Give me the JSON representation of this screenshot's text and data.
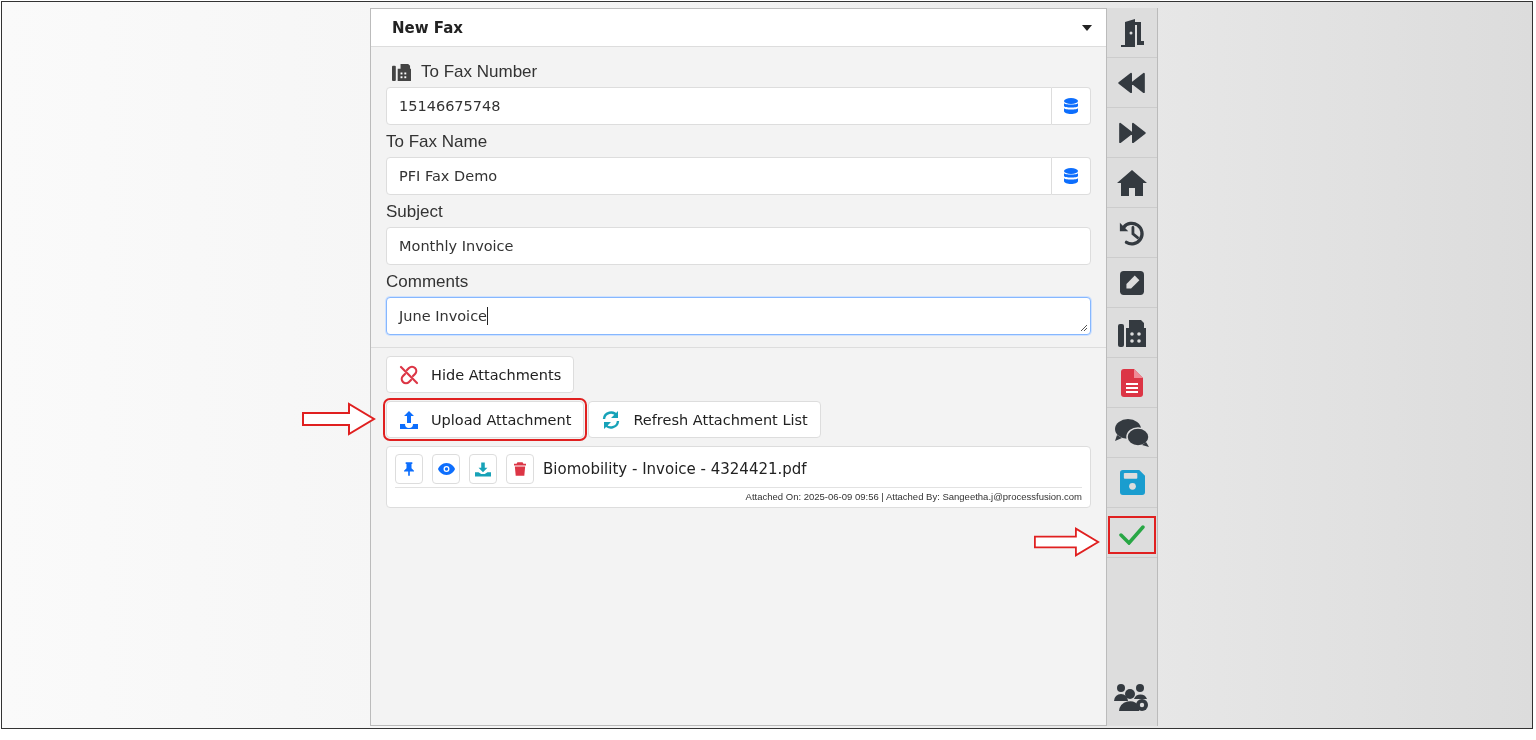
{
  "panel": {
    "title": "New Fax"
  },
  "fields": [
    {
      "kind": "lookup",
      "label": "To Fax Number",
      "label_icon": true,
      "value": "15146675748",
      "focused": false
    },
    {
      "kind": "lookup",
      "label": "To Fax Name",
      "label_icon": false,
      "value": "PFI Fax Demo",
      "focused": false
    },
    {
      "kind": "text",
      "label": "Subject",
      "label_icon": false,
      "value": "Monthly Invoice",
      "focused": false
    },
    {
      "kind": "textarea",
      "label": "Comments",
      "label_icon": false,
      "value": "June Invoice",
      "focused": true
    }
  ],
  "hide_button": {
    "label": "Hide Attachments"
  },
  "attachment_buttons": [
    {
      "kind": "upload",
      "label": "Upload Attachment",
      "highlighted": true
    },
    {
      "kind": "refresh",
      "label": "Refresh Attachment List",
      "highlighted": false
    }
  ],
  "attachments": [
    {
      "name": "Biomobility - Invoice - 4324421.pdf",
      "meta": "Attached On: 2025-06-09 09:56 | Attached By: Sangeetha.j@processfusion.com"
    }
  ],
  "toolbar": [
    {
      "kind": "exit",
      "highlighted": false
    },
    {
      "kind": "rewind",
      "highlighted": false
    },
    {
      "kind": "forward",
      "highlighted": false
    },
    {
      "kind": "home",
      "highlighted": false
    },
    {
      "kind": "history",
      "highlighted": false
    },
    {
      "kind": "edit",
      "highlighted": false
    },
    {
      "kind": "fax",
      "highlighted": false
    },
    {
      "kind": "document",
      "highlighted": false
    },
    {
      "kind": "chat",
      "highlighted": false
    },
    {
      "kind": "save",
      "highlighted": false
    },
    {
      "kind": "confirm",
      "highlighted": true
    }
  ],
  "toolbar_bottom": {
    "kind": "users-settings"
  }
}
